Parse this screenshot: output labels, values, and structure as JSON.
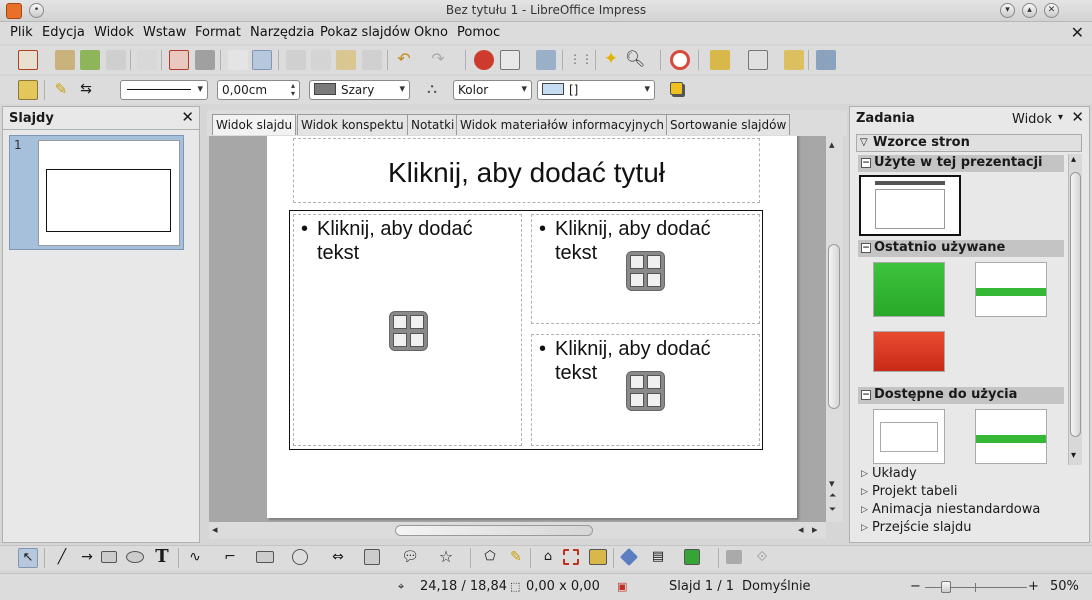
{
  "window": {
    "title": "Bez tytułu 1 - LibreOffice Impress"
  },
  "menu": [
    "Plik",
    "Edycja",
    "Widok",
    "Wstaw",
    "Format",
    "Narzędzia",
    "Pokaz slajdów",
    "Okno",
    "Pomoc"
  ],
  "format_bar": {
    "line_width": "0,00cm",
    "area_color": "Szary",
    "area_style": "Kolor",
    "area_fill": "[]",
    "colors": {
      "area_swatch": "#7a7a7a",
      "fill_swatch": "#c6dcf0"
    }
  },
  "slides_panel": {
    "title": "Slajdy",
    "slide_number": "1"
  },
  "view_tabs": [
    "Widok slajdu",
    "Widok konspektu",
    "Notatki",
    "Widok materiałów informacyjnych",
    "Sortowanie slajdów"
  ],
  "slide": {
    "title_placeholder": "Kliknij, aby dodać tytuł",
    "left_text": [
      "Kliknij, aby dodać",
      "tekst"
    ],
    "right_top_text": [
      "Kliknij, aby dodać",
      "tekst"
    ],
    "right_bottom_text": [
      "Kliknij, aby dodać",
      "tekst"
    ],
    "bullet": "•"
  },
  "tasks_panel": {
    "title": "Zadania",
    "view_label": "Widok",
    "section_masters": "Wzorce stron",
    "used_in_presentation": "Użyte w tej prezentacji",
    "recently_used": "Ostatnio używane",
    "available": "Dostępne do użycia",
    "collapsed": [
      "Układy",
      "Projekt tabeli",
      "Animacja niestandardowa",
      "Przejście slajdu"
    ]
  },
  "status": {
    "position": "24,18 / 18,84",
    "size": "0,00 x 0,00",
    "slide": "Slajd 1 / 1",
    "layout": "Domyślnie",
    "zoom": "50%"
  }
}
